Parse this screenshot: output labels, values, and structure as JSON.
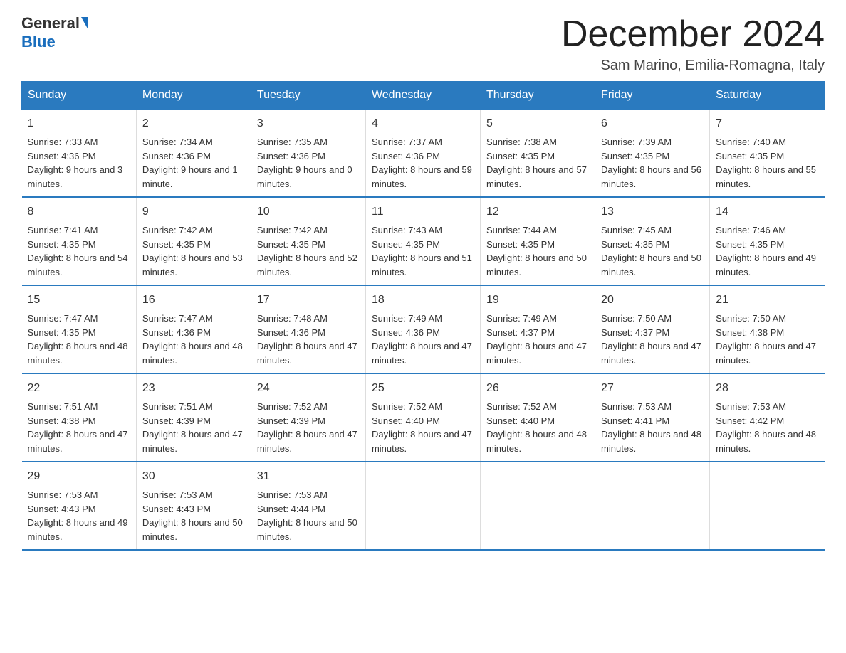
{
  "logo": {
    "general": "General",
    "blue": "Blue"
  },
  "title": "December 2024",
  "subtitle": "Sam Marino, Emilia-Romagna, Italy",
  "days_of_week": [
    "Sunday",
    "Monday",
    "Tuesday",
    "Wednesday",
    "Thursday",
    "Friday",
    "Saturday"
  ],
  "weeks": [
    [
      {
        "day": "1",
        "sunrise": "7:33 AM",
        "sunset": "4:36 PM",
        "daylight": "9 hours and 3 minutes."
      },
      {
        "day": "2",
        "sunrise": "7:34 AM",
        "sunset": "4:36 PM",
        "daylight": "9 hours and 1 minute."
      },
      {
        "day": "3",
        "sunrise": "7:35 AM",
        "sunset": "4:36 PM",
        "daylight": "9 hours and 0 minutes."
      },
      {
        "day": "4",
        "sunrise": "7:37 AM",
        "sunset": "4:36 PM",
        "daylight": "8 hours and 59 minutes."
      },
      {
        "day": "5",
        "sunrise": "7:38 AM",
        "sunset": "4:35 PM",
        "daylight": "8 hours and 57 minutes."
      },
      {
        "day": "6",
        "sunrise": "7:39 AM",
        "sunset": "4:35 PM",
        "daylight": "8 hours and 56 minutes."
      },
      {
        "day": "7",
        "sunrise": "7:40 AM",
        "sunset": "4:35 PM",
        "daylight": "8 hours and 55 minutes."
      }
    ],
    [
      {
        "day": "8",
        "sunrise": "7:41 AM",
        "sunset": "4:35 PM",
        "daylight": "8 hours and 54 minutes."
      },
      {
        "day": "9",
        "sunrise": "7:42 AM",
        "sunset": "4:35 PM",
        "daylight": "8 hours and 53 minutes."
      },
      {
        "day": "10",
        "sunrise": "7:42 AM",
        "sunset": "4:35 PM",
        "daylight": "8 hours and 52 minutes."
      },
      {
        "day": "11",
        "sunrise": "7:43 AM",
        "sunset": "4:35 PM",
        "daylight": "8 hours and 51 minutes."
      },
      {
        "day": "12",
        "sunrise": "7:44 AM",
        "sunset": "4:35 PM",
        "daylight": "8 hours and 50 minutes."
      },
      {
        "day": "13",
        "sunrise": "7:45 AM",
        "sunset": "4:35 PM",
        "daylight": "8 hours and 50 minutes."
      },
      {
        "day": "14",
        "sunrise": "7:46 AM",
        "sunset": "4:35 PM",
        "daylight": "8 hours and 49 minutes."
      }
    ],
    [
      {
        "day": "15",
        "sunrise": "7:47 AM",
        "sunset": "4:35 PM",
        "daylight": "8 hours and 48 minutes."
      },
      {
        "day": "16",
        "sunrise": "7:47 AM",
        "sunset": "4:36 PM",
        "daylight": "8 hours and 48 minutes."
      },
      {
        "day": "17",
        "sunrise": "7:48 AM",
        "sunset": "4:36 PM",
        "daylight": "8 hours and 47 minutes."
      },
      {
        "day": "18",
        "sunrise": "7:49 AM",
        "sunset": "4:36 PM",
        "daylight": "8 hours and 47 minutes."
      },
      {
        "day": "19",
        "sunrise": "7:49 AM",
        "sunset": "4:37 PM",
        "daylight": "8 hours and 47 minutes."
      },
      {
        "day": "20",
        "sunrise": "7:50 AM",
        "sunset": "4:37 PM",
        "daylight": "8 hours and 47 minutes."
      },
      {
        "day": "21",
        "sunrise": "7:50 AM",
        "sunset": "4:38 PM",
        "daylight": "8 hours and 47 minutes."
      }
    ],
    [
      {
        "day": "22",
        "sunrise": "7:51 AM",
        "sunset": "4:38 PM",
        "daylight": "8 hours and 47 minutes."
      },
      {
        "day": "23",
        "sunrise": "7:51 AM",
        "sunset": "4:39 PM",
        "daylight": "8 hours and 47 minutes."
      },
      {
        "day": "24",
        "sunrise": "7:52 AM",
        "sunset": "4:39 PM",
        "daylight": "8 hours and 47 minutes."
      },
      {
        "day": "25",
        "sunrise": "7:52 AM",
        "sunset": "4:40 PM",
        "daylight": "8 hours and 47 minutes."
      },
      {
        "day": "26",
        "sunrise": "7:52 AM",
        "sunset": "4:40 PM",
        "daylight": "8 hours and 48 minutes."
      },
      {
        "day": "27",
        "sunrise": "7:53 AM",
        "sunset": "4:41 PM",
        "daylight": "8 hours and 48 minutes."
      },
      {
        "day": "28",
        "sunrise": "7:53 AM",
        "sunset": "4:42 PM",
        "daylight": "8 hours and 48 minutes."
      }
    ],
    [
      {
        "day": "29",
        "sunrise": "7:53 AM",
        "sunset": "4:43 PM",
        "daylight": "8 hours and 49 minutes."
      },
      {
        "day": "30",
        "sunrise": "7:53 AM",
        "sunset": "4:43 PM",
        "daylight": "8 hours and 50 minutes."
      },
      {
        "day": "31",
        "sunrise": "7:53 AM",
        "sunset": "4:44 PM",
        "daylight": "8 hours and 50 minutes."
      },
      null,
      null,
      null,
      null
    ]
  ],
  "labels": {
    "sunrise": "Sunrise:",
    "sunset": "Sunset:",
    "daylight": "Daylight:"
  }
}
